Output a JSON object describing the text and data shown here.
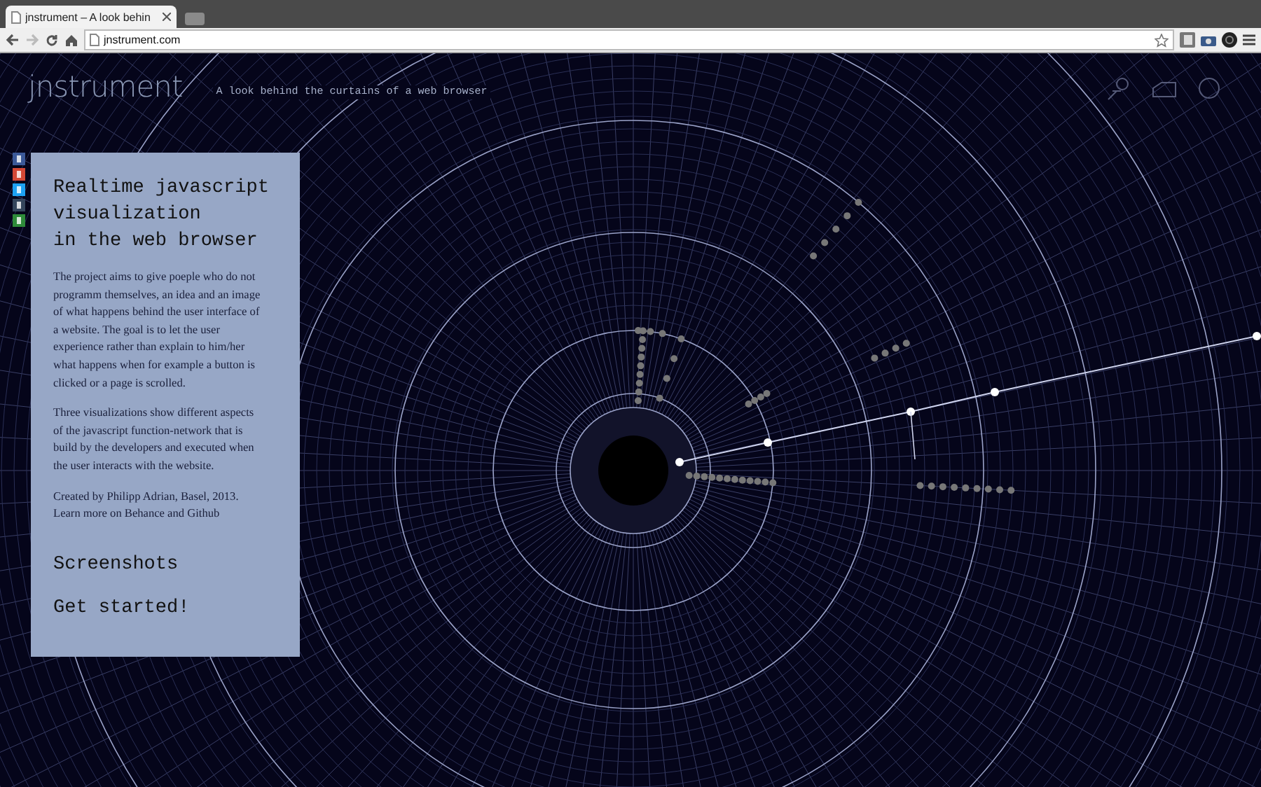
{
  "browser": {
    "tab_title": "jnstrument – A look behin",
    "url": "jnstrument.com"
  },
  "header": {
    "logo": "jnstrument",
    "tagline": "A look behind the curtains of a web browser"
  },
  "panel": {
    "title": [
      "Realtime javascript",
      "visualization",
      "in the web browser"
    ],
    "paragraphs": [
      "The project aims to give poeple who do not programm themselves, an idea and an image of what happens behind the user interface of a website. The goal is to let the user experience rather than explain to him/her what happens when for example a button is clicked or a page is scrolled.",
      "Three visualizations show different aspects of the javascript function-network that is build by the developers and executed when the user interacts with the website."
    ],
    "credits": [
      "Created by Philipp Adrian, Basel, 2013.",
      "Learn more on Behance and Github"
    ],
    "links": [
      "Screenshots",
      "Get started!"
    ]
  }
}
